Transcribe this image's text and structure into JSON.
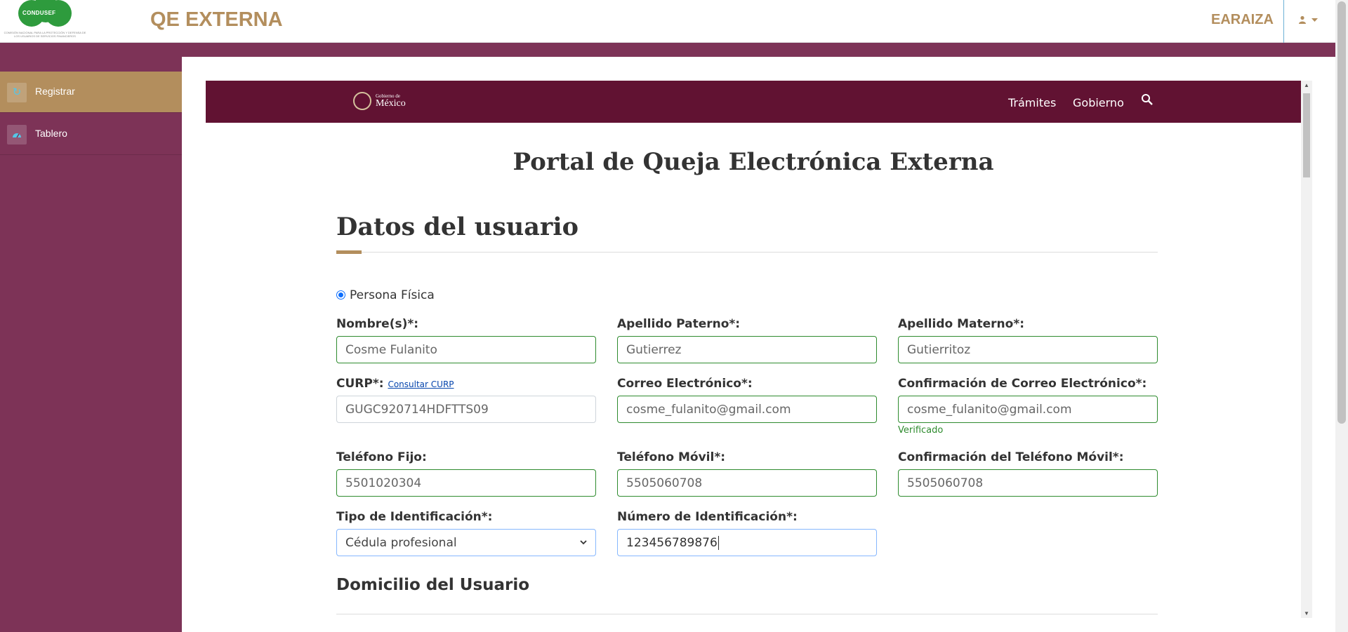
{
  "header": {
    "logo_text": "CONDUSEF",
    "logo_subtext": "COMISIÓN NACIONAL PARA LA PROTECCIÓN Y DEFENSA DE LOS USUARIOS DE SERVICIOS FINANCIEROS",
    "app_title": "QE EXTERNA",
    "user_name": "EARAIZA",
    "user_menu_icon": "user-icon"
  },
  "sidebar": {
    "items": [
      {
        "label": "Registrar",
        "icon": "refresh-icon",
        "active": true
      },
      {
        "label": "Tablero",
        "icon": "dashboard-icon",
        "active": false
      }
    ]
  },
  "gob_nav": {
    "logo_small": "Gobierno de",
    "logo_big": "México",
    "links": [
      "Trámites",
      "Gobierno"
    ],
    "search_icon": "search-icon"
  },
  "portal_title": "Portal de Queja Electrónica Externa",
  "section_title": "Datos del usuario",
  "person_type": "Persona Física",
  "fields": {
    "nombre": {
      "label": "Nombre(s)*:",
      "value": "Cosme Fulanito"
    },
    "apellido_paterno": {
      "label": "Apellido Paterno*:",
      "value": "Gutierrez"
    },
    "apellido_materno": {
      "label": "Apellido Materno*:",
      "value": "Gutierritoz"
    },
    "curp": {
      "label": "CURP*:",
      "link": "Consultar CURP",
      "value": "GUGC920714HDFTTS09"
    },
    "correo": {
      "label": "Correo Electrónico*:",
      "value": "cosme_fulanito@gmail.com"
    },
    "correo_confirm": {
      "label": "Confirmación de Correo Electrónico*:",
      "value": "cosme_fulanito@gmail.com",
      "hint": "Verificado"
    },
    "telefono_fijo": {
      "label": "Teléfono Fijo:",
      "value": "5501020304"
    },
    "telefono_movil": {
      "label": "Teléfono Móvil*:",
      "value": "5505060708"
    },
    "telefono_movil_confirm": {
      "label": "Confirmación del Teléfono Móvil*:",
      "value": "5505060708"
    },
    "tipo_identificacion": {
      "label": "Tipo de Identificación*:",
      "value": "Cédula profesional"
    },
    "numero_identificacion": {
      "label": "Número de Identificación*:",
      "value": "123456789876"
    }
  },
  "subsection_title": "Domicilio del Usuario",
  "colors": {
    "brand_purple": "#7d3357",
    "gob_maroon": "#611232",
    "gold": "#b38e5d",
    "valid_green": "#2e8b2e"
  }
}
